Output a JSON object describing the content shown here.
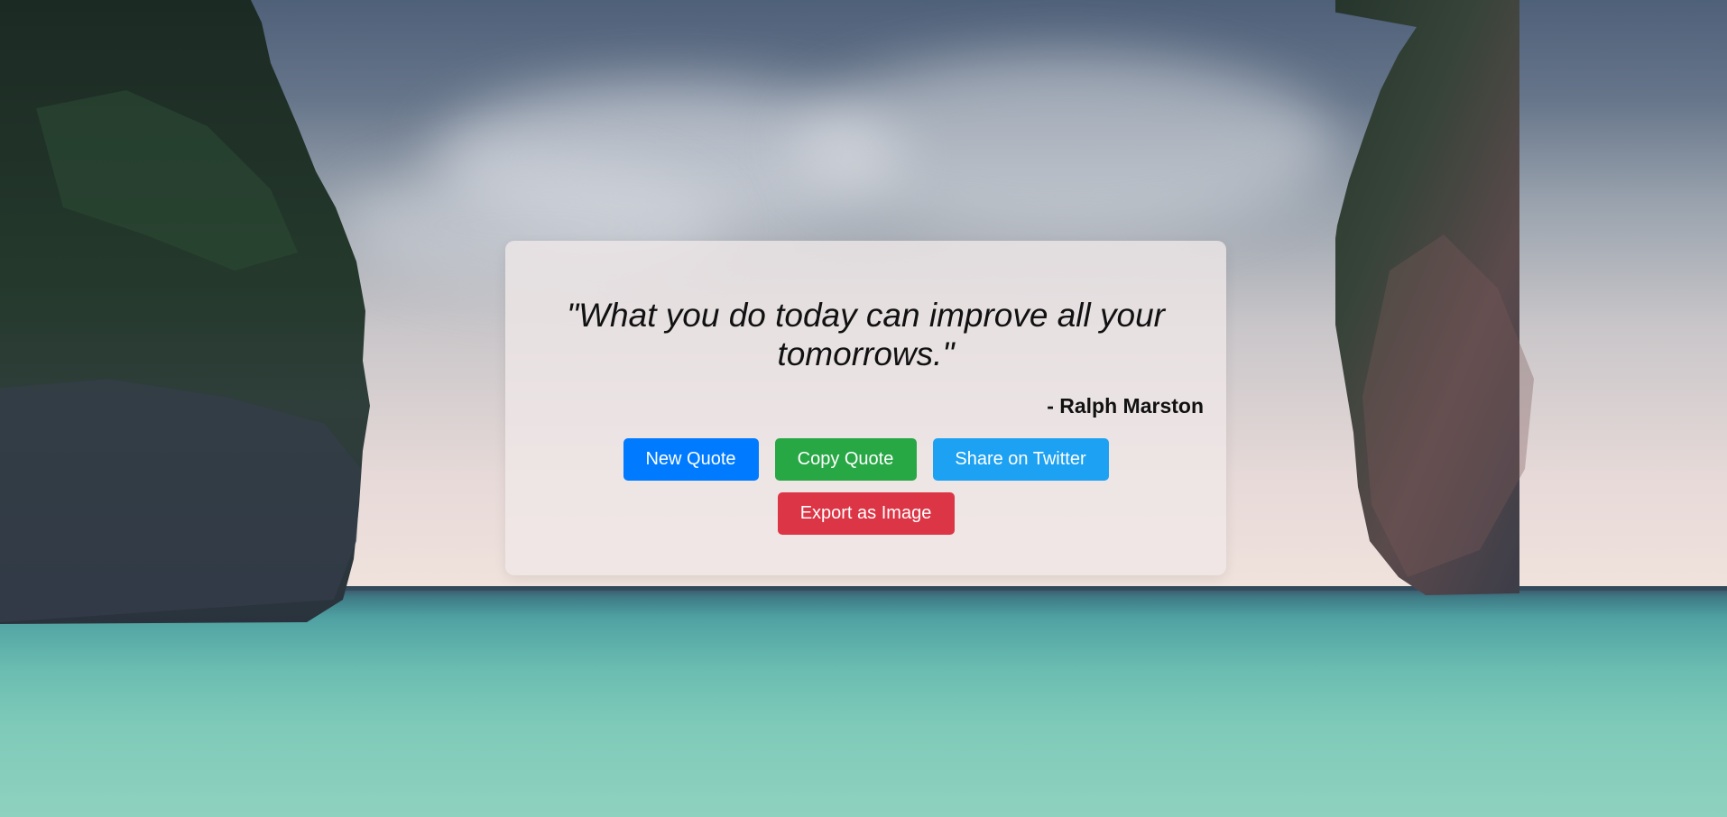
{
  "quote": {
    "text": "\"What you do today can improve all your tomorrows.\"",
    "author": "- Ralph Marston"
  },
  "buttons": {
    "new_quote": "New Quote",
    "copy_quote": "Copy Quote",
    "share_twitter": "Share on Twitter",
    "export_image": "Export as Image"
  },
  "colors": {
    "new_quote": "#007bff",
    "copy_quote": "#28a745",
    "share_twitter": "#1da1f2",
    "export_image": "#dc3545"
  }
}
